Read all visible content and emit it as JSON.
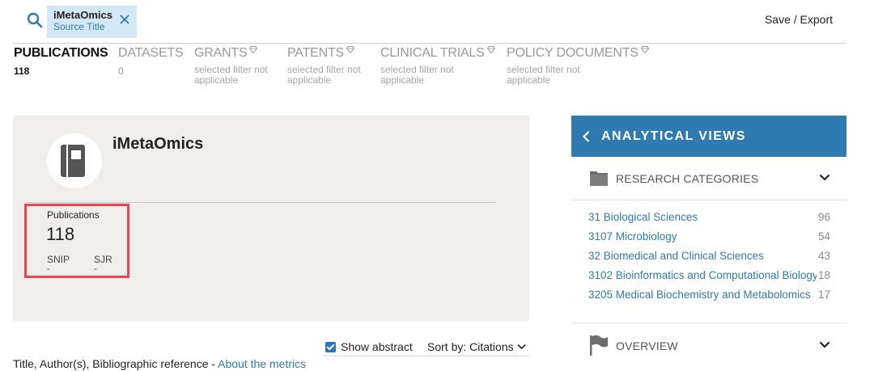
{
  "search": {
    "chip_title": "iMetaOmics",
    "chip_subtitle": "Source Title"
  },
  "header": {
    "save_export": "Save / Export"
  },
  "tabs": [
    {
      "label": "PUBLICATIONS",
      "count": "118",
      "note": "",
      "premium": false,
      "active": true
    },
    {
      "label": "DATASETS",
      "count": "0",
      "note": "",
      "premium": false,
      "active": false
    },
    {
      "label": "GRANTS",
      "count": "",
      "note": "selected filter not applicable",
      "premium": true,
      "active": false
    },
    {
      "label": "PATENTS",
      "count": "",
      "note": "selected filter not applicable",
      "premium": true,
      "active": false
    },
    {
      "label": "CLINICAL TRIALS",
      "count": "",
      "note": "selected filter not applicable",
      "premium": true,
      "active": false
    },
    {
      "label": "POLICY DOCUMENTS",
      "count": "",
      "note": "selected filter not applicable",
      "premium": true,
      "active": false
    }
  ],
  "source_card": {
    "title": "iMetaOmics",
    "publications_label": "Publications",
    "publications_value": "118",
    "snip_label": "SNIP",
    "snip_value": "-",
    "sjr_label": "SJR",
    "sjr_value": "-"
  },
  "results_toolbar": {
    "show_abstract_label": "Show abstract",
    "show_abstract_checked": true,
    "sort_label": "Sort by:",
    "sort_value": "Citations",
    "bib_text": "Title, Author(s), Bibliographic reference - ",
    "metrics_link": "About the metrics"
  },
  "analytical_views": {
    "title": "ANALYTICAL VIEWS",
    "research_categories_label": "RESEARCH CATEGORIES",
    "categories": [
      {
        "name": "31 Biological Sciences",
        "count": "96"
      },
      {
        "name": "3107 Microbiology",
        "count": "54"
      },
      {
        "name": "32 Biomedical and Clinical Sciences",
        "count": "43"
      },
      {
        "name": "3102 Bioinformatics and Computational Biology",
        "count": "18"
      },
      {
        "name": "3205 Medical Biochemistry and Metabolomics",
        "count": "17"
      }
    ],
    "overview_label": "OVERVIEW"
  },
  "colors": {
    "accent": "#2f7ab0",
    "chip_bg": "#d4e7f4",
    "card_bg": "#efeeeb",
    "highlight": "#e5484d"
  },
  "icons": [
    "search-icon",
    "close-icon",
    "diamond-icon",
    "book-icon",
    "chevron-left-icon",
    "folder-icon",
    "flag-icon",
    "chevron-down-icon"
  ]
}
